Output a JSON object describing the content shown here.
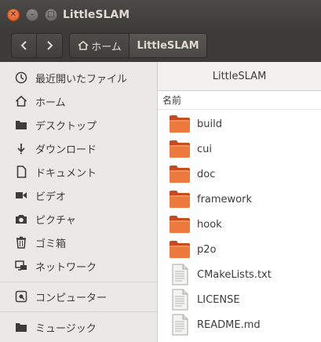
{
  "window": {
    "title": "LittleSLAM"
  },
  "toolbar": {
    "breadcrumb_home": "ホーム",
    "breadcrumb_current": "LittleSLAM"
  },
  "sidebar": {
    "items": [
      {
        "label": "最近開いたファイル",
        "icon": "clock-icon"
      },
      {
        "label": "ホーム",
        "icon": "home-icon"
      },
      {
        "label": "デスクトップ",
        "icon": "folder-icon"
      },
      {
        "label": "ダウンロード",
        "icon": "download-icon"
      },
      {
        "label": "ドキュメント",
        "icon": "document-icon"
      },
      {
        "label": "ビデオ",
        "icon": "video-icon"
      },
      {
        "label": "ピクチャ",
        "icon": "camera-icon"
      },
      {
        "label": "ゴミ箱",
        "icon": "trash-icon"
      },
      {
        "label": "ネットワーク",
        "icon": "network-icon"
      },
      {
        "label": "コンピューター",
        "icon": "computer-icon"
      },
      {
        "label": "ミュージック",
        "icon": "music-folder-icon"
      }
    ]
  },
  "main": {
    "location": "LittleSLAM",
    "column_header": "名前",
    "files": [
      {
        "name": "build",
        "type": "folder"
      },
      {
        "name": "cui",
        "type": "folder"
      },
      {
        "name": "doc",
        "type": "folder"
      },
      {
        "name": "framework",
        "type": "folder"
      },
      {
        "name": "hook",
        "type": "folder"
      },
      {
        "name": "p2o",
        "type": "folder"
      },
      {
        "name": "CMakeLists.txt",
        "type": "file"
      },
      {
        "name": "LICENSE",
        "type": "file"
      },
      {
        "name": "README.md",
        "type": "file"
      }
    ]
  },
  "colors": {
    "titlebar": "#3c3b37",
    "close_button": "#e2541b",
    "folder_orange": "#e8662c",
    "sidebar_bg": "#ebe9e7"
  }
}
